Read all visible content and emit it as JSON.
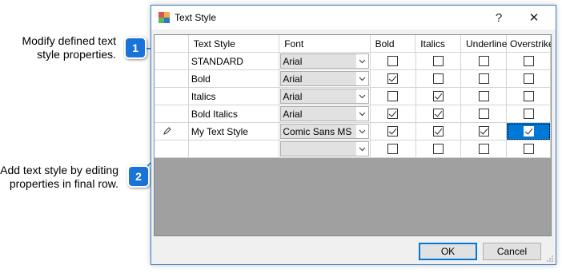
{
  "callouts": [
    {
      "number": "1",
      "text_line1": "Modify defined text",
      "text_line2": "style properties."
    },
    {
      "number": "2",
      "text_line1": "Add text style by editing",
      "text_line2": "properties in final row."
    }
  ],
  "window": {
    "title": "Text Style",
    "help_label": "?",
    "close_label": "✕",
    "ok_label": "OK",
    "cancel_label": "Cancel"
  },
  "grid": {
    "columns": [
      "",
      "Text Style",
      "Font",
      "Bold",
      "Italics",
      "Underline",
      "Overstrike"
    ],
    "rows": [
      {
        "indicator": "",
        "name": "STANDARD",
        "font": "Arial",
        "bold": false,
        "italics": false,
        "underline": false,
        "overstrike": false
      },
      {
        "indicator": "",
        "name": "Bold",
        "font": "Arial",
        "bold": true,
        "italics": false,
        "underline": false,
        "overstrike": false
      },
      {
        "indicator": "",
        "name": "Italics",
        "font": "Arial",
        "bold": false,
        "italics": true,
        "underline": false,
        "overstrike": false
      },
      {
        "indicator": "",
        "name": "Bold Italics",
        "font": "Arial",
        "bold": true,
        "italics": true,
        "underline": false,
        "overstrike": false
      },
      {
        "indicator": "pencil-icon",
        "name": "My Text Style",
        "font": "Comic Sans MS",
        "bold": true,
        "italics": true,
        "underline": true,
        "overstrike": true
      },
      {
        "indicator": "",
        "name": "",
        "font": "",
        "bold": false,
        "italics": false,
        "underline": false,
        "overstrike": false
      }
    ]
  },
  "colors": {
    "accent": "#1a73d9",
    "selection": "#0078d7",
    "grid_background": "#a0a0a0"
  }
}
